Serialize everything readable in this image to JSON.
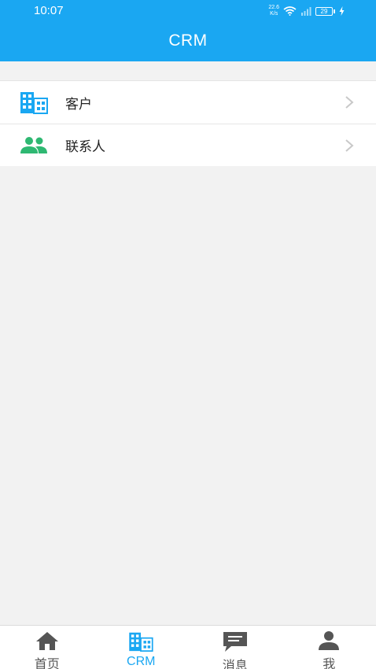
{
  "status_bar": {
    "time": "10:07",
    "net_speed_value": "22.6",
    "net_speed_unit": "K/s",
    "battery": "29"
  },
  "header": {
    "title": "CRM"
  },
  "menu": {
    "items": [
      {
        "label": "客户",
        "icon": "building-icon"
      },
      {
        "label": "联系人",
        "icon": "contacts-icon"
      }
    ]
  },
  "bottom_nav": {
    "active": "CRM",
    "items": [
      {
        "label": "首页",
        "icon": "home-icon"
      },
      {
        "label": "CRM",
        "icon": "building-icon"
      },
      {
        "label": "消息",
        "icon": "message-icon"
      },
      {
        "label": "我",
        "icon": "person-icon"
      }
    ]
  },
  "colors": {
    "primary": "#1aa7f2",
    "contacts_green": "#2fb872",
    "inactive_icon": "#555555",
    "background": "#f2f2f2"
  }
}
